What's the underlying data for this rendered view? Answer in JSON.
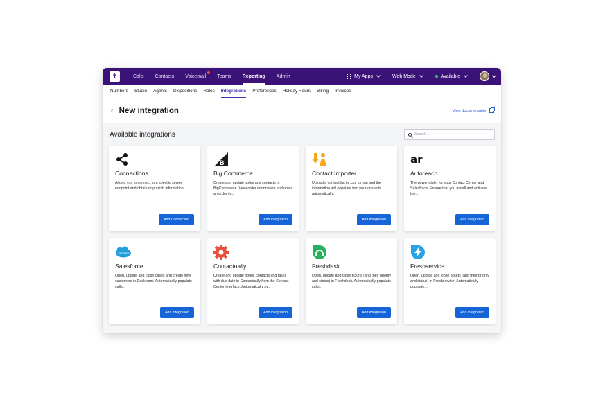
{
  "topnav": {
    "items": [
      "Calls",
      "Contacts",
      "Voicemail",
      "Teams",
      "Reporting",
      "Admin"
    ],
    "my_apps": "My Apps",
    "web_mode": "Web Mode",
    "status": "Available"
  },
  "subnav": {
    "items": [
      "Numbers",
      "Studio",
      "Agents",
      "Dispositions",
      "Roles",
      "Integrations",
      "Preferences",
      "Holiday Hours",
      "Billing",
      "Invoices"
    ]
  },
  "header": {
    "back": "‹",
    "title": "New integration",
    "doc_link": "View documentation"
  },
  "section": {
    "title": "Available integrations",
    "search_placeholder": "Search..."
  },
  "cards": [
    {
      "icon": "share-icon",
      "name": "Connections",
      "desc": "Allows you to connect to a specific server endpoint and obtain or publish information.",
      "button": "Add Connection"
    },
    {
      "icon": "bigcommerce-icon",
      "name": "Big Commerce",
      "desc": "Create and update notes and contacts in BigCommerce. View order information and open an order in...",
      "button": "Add integration"
    },
    {
      "icon": "contact-importer-icon",
      "name": "Contact Importer",
      "desc": "Upload a contact list in .csv format and the information will populate into your contacts automatically.",
      "button": "Add integration"
    },
    {
      "icon": "autoreach-icon",
      "name": "Autoreach",
      "desc": "The power dialer for your Contact Center and Salesforce. Ensure that you install and activate the...",
      "button": "Add integration"
    },
    {
      "icon": "salesforce-icon",
      "name": "Salesforce",
      "desc": "Open, update and close cases and create new customers in Desk.com. Automatically populate calls...",
      "button": "Add integration"
    },
    {
      "icon": "contactually-icon",
      "name": "Contactually",
      "desc": "Create and update notes, contacts and tasks with due date in Contactually from the Contact Center interface. Automatically sy...",
      "button": "Add integration"
    },
    {
      "icon": "freshdesk-icon",
      "name": "Freshdesk",
      "desc": "Open, update and close tickets (and their priority and status) in Freshdesk. Automatically populate calls...",
      "button": "Add integration"
    },
    {
      "icon": "freshservice-icon",
      "name": "Freshservice",
      "desc": "Open, update and close tickets (and their priority and status) in Freshservice. Automatically populate...",
      "button": "Add integration"
    }
  ],
  "colors": {
    "nav_bg": "#3b1278",
    "accent": "#4a2ca8",
    "button": "#1565d8",
    "status_available": "#3ec46d"
  }
}
